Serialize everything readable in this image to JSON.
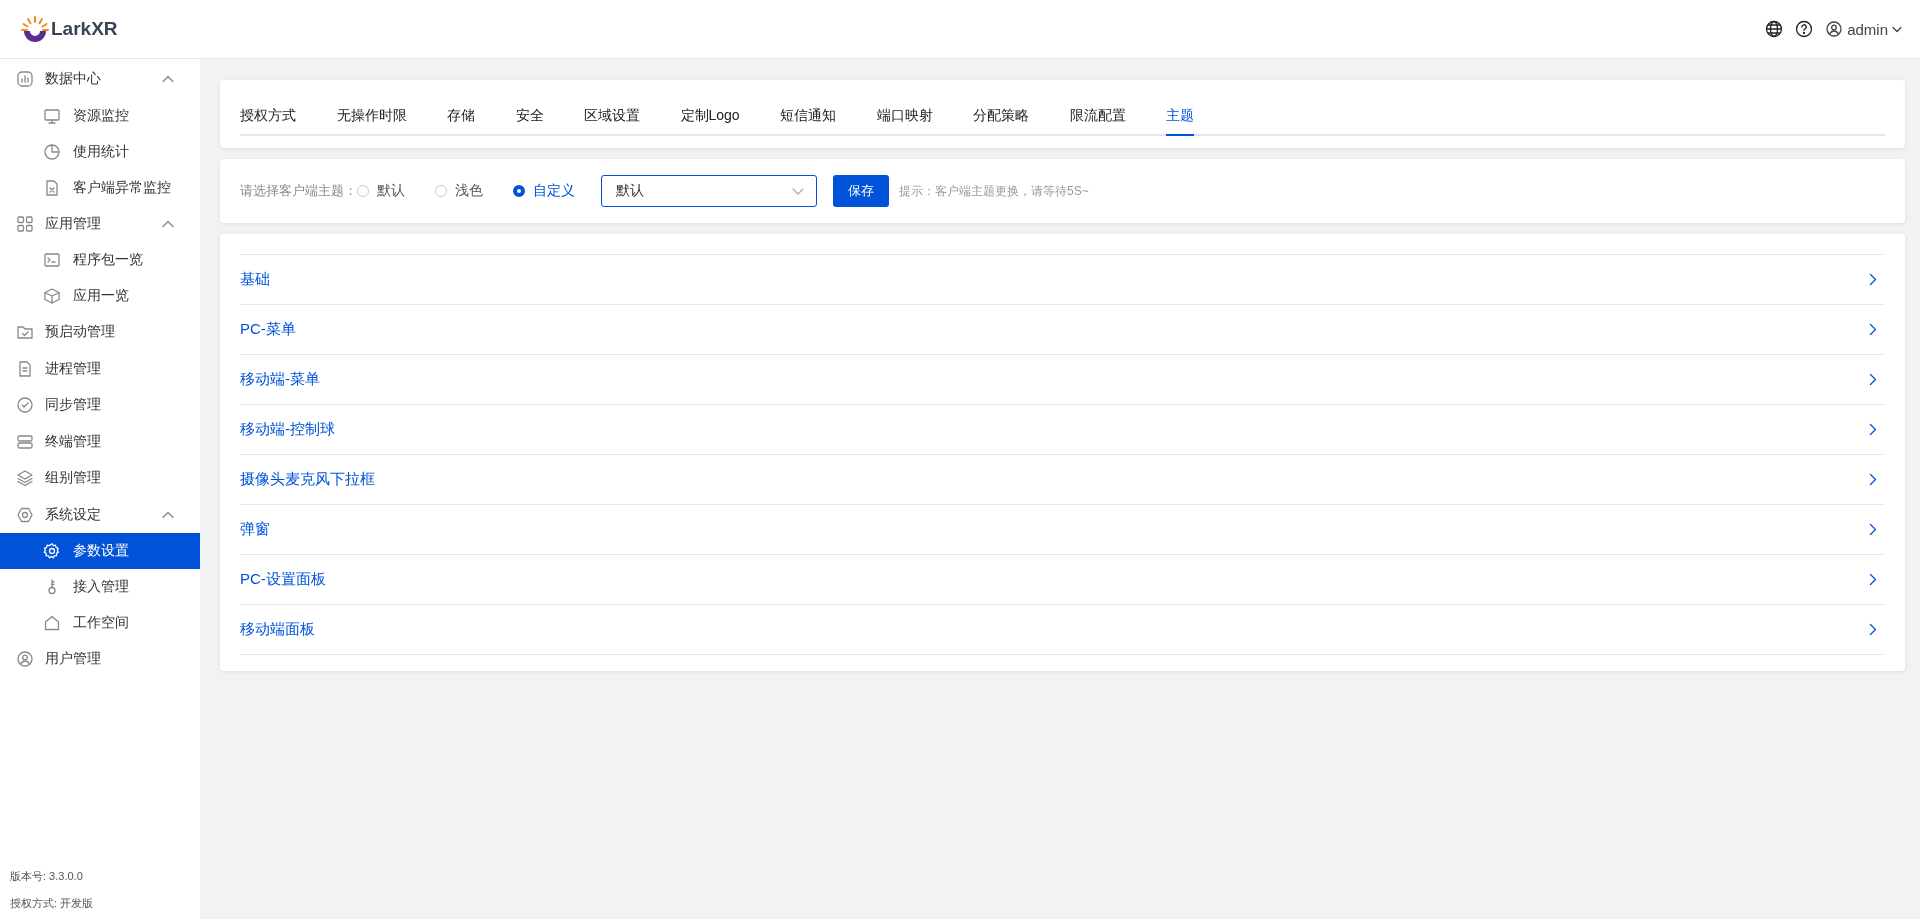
{
  "header": {
    "logo": "LarkXR",
    "user": "admin"
  },
  "sidebar": {
    "items": [
      {
        "label": "数据中心",
        "selected": false,
        "expanded": true,
        "children": [
          {
            "label": "资源监控",
            "selected": false
          },
          {
            "label": "使用统计",
            "selected": false
          },
          {
            "label": "客户端异常监控",
            "selected": false
          }
        ]
      },
      {
        "label": "应用管理",
        "selected": false,
        "expanded": true,
        "children": [
          {
            "label": "程序包一览",
            "selected": false
          },
          {
            "label": "应用一览",
            "selected": false
          }
        ]
      },
      {
        "label": "预启动管理",
        "selected": false
      },
      {
        "label": "进程管理",
        "selected": false
      },
      {
        "label": "同步管理",
        "selected": false
      },
      {
        "label": "终端管理",
        "selected": false
      },
      {
        "label": "组别管理",
        "selected": false
      },
      {
        "label": "系统设定",
        "selected": false,
        "expanded": true,
        "children": [
          {
            "label": "参数设置",
            "selected": true
          },
          {
            "label": "接入管理",
            "selected": false
          },
          {
            "label": "工作空间",
            "selected": false
          }
        ]
      },
      {
        "label": "用户管理",
        "selected": false
      }
    ],
    "version": "版本号: 3.3.0.0",
    "license": "授权方式: 开发版"
  },
  "tabs": [
    {
      "label": "授权方式",
      "selected": false
    },
    {
      "label": "无操作时限",
      "selected": false
    },
    {
      "label": "存储",
      "selected": false
    },
    {
      "label": "安全",
      "selected": false
    },
    {
      "label": "区域设置",
      "selected": false
    },
    {
      "label": "定制Logo",
      "selected": false
    },
    {
      "label": "短信通知",
      "selected": false
    },
    {
      "label": "端口映射",
      "selected": false
    },
    {
      "label": "分配策略",
      "selected": false
    },
    {
      "label": "限流配置",
      "selected": false
    },
    {
      "label": "主题",
      "selected": true
    }
  ],
  "theme": {
    "label": "请选择客户端主题：",
    "options": [
      {
        "label": "默认",
        "selected": false
      },
      {
        "label": "浅色",
        "selected": false
      },
      {
        "label": "自定义",
        "selected": true
      }
    ],
    "dropdown": {
      "value": "默认"
    },
    "save": "保存",
    "hint": "提示：客户端主题更换，请等待5S~"
  },
  "sections": [
    {
      "label": "基础"
    },
    {
      "label": "PC-菜单"
    },
    {
      "label": "移动端-菜单"
    },
    {
      "label": "移动端-控制球"
    },
    {
      "label": "摄像头麦克风下拉框"
    },
    {
      "label": "弹窗"
    },
    {
      "label": "PC-设置面板"
    },
    {
      "label": "移动端面板"
    }
  ]
}
